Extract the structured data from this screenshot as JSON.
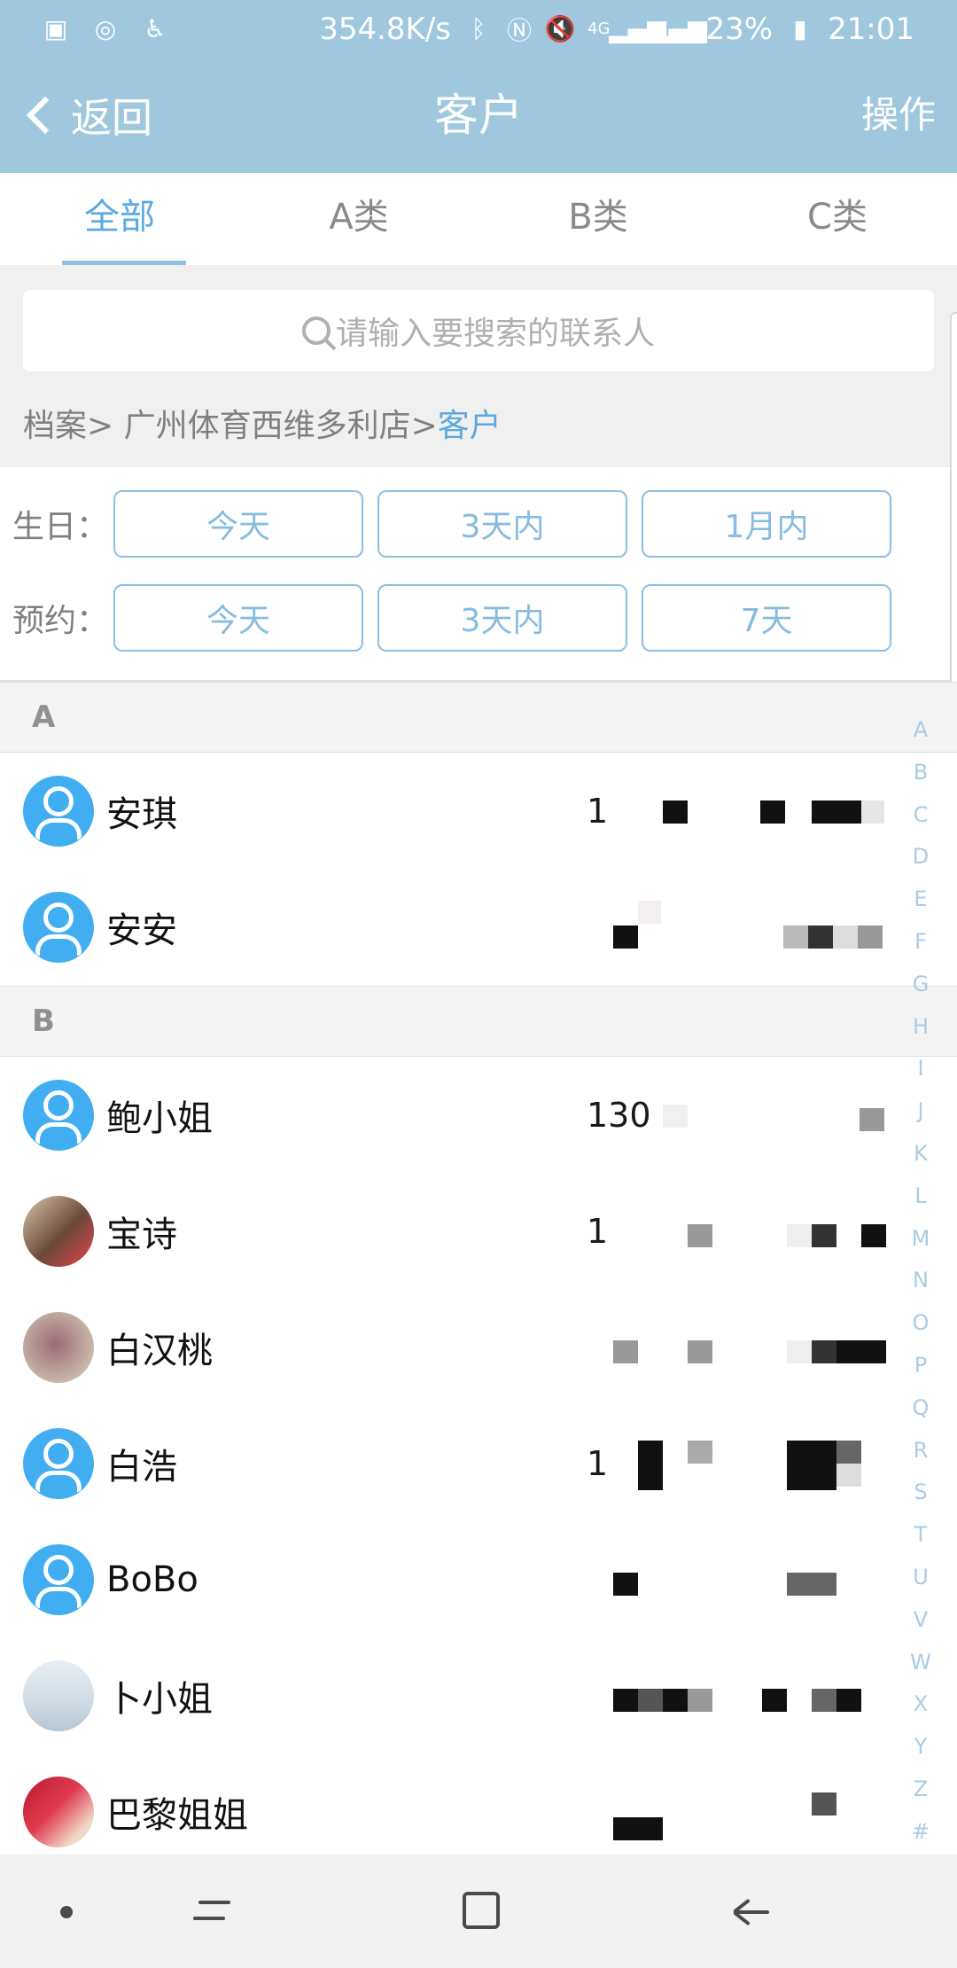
{
  "status_bar": {
    "speed": "354.8K/s",
    "network": "4G",
    "battery": "23%",
    "time": "21:01"
  },
  "header": {
    "back_label": "返回",
    "title": "客户",
    "action_label": "操作"
  },
  "tabs": [
    "全部",
    "A类",
    "B类",
    "C类"
  ],
  "search": {
    "placeholder": "请输入要搜索的联系人"
  },
  "breadcrumb": {
    "path": "档案> 广州体育西维多利店>",
    "current": "客户"
  },
  "filters": {
    "birthday": {
      "label": "生日：",
      "options": [
        "今天",
        "3天内",
        "1月内"
      ]
    },
    "appointment": {
      "label": "预约：",
      "options": [
        "今天",
        "3天内",
        "7天"
      ]
    }
  },
  "sections": [
    {
      "letter": "A",
      "contacts": [
        {
          "name": "安琪",
          "avatar": "default-user-icon",
          "phone_prefix": "1"
        },
        {
          "name": "安安",
          "avatar": "default-user-icon",
          "phone_prefix": ""
        }
      ]
    },
    {
      "letter": "B",
      "contacts": [
        {
          "name": "鲍小姐",
          "avatar": "default-user-icon",
          "phone_prefix": "130"
        },
        {
          "name": "宝诗",
          "avatar": "photo",
          "phone_prefix": "1"
        },
        {
          "name": "白汉桃",
          "avatar": "photo",
          "phone_prefix": ""
        },
        {
          "name": "白浩",
          "avatar": "default-user-icon",
          "phone_prefix": "1"
        },
        {
          "name": "BoBo",
          "avatar": "default-user-icon",
          "phone_prefix": ""
        },
        {
          "name": "卜小姐",
          "avatar": "photo",
          "phone_prefix": ""
        },
        {
          "name": "巴黎姐姐",
          "avatar": "photo",
          "phone_prefix": ""
        }
      ]
    }
  ],
  "alphabet_index": [
    "A",
    "B",
    "C",
    "D",
    "E",
    "F",
    "G",
    "H",
    "I",
    "J",
    "K",
    "L",
    "M",
    "N",
    "O",
    "P",
    "Q",
    "R",
    "S",
    "T",
    "U",
    "V",
    "W",
    "X",
    "Y",
    "Z",
    "#"
  ],
  "colors": {
    "header_bg": "#9fc8de",
    "accent": "#5aaadf",
    "avatar_blue": "#40aef0"
  }
}
